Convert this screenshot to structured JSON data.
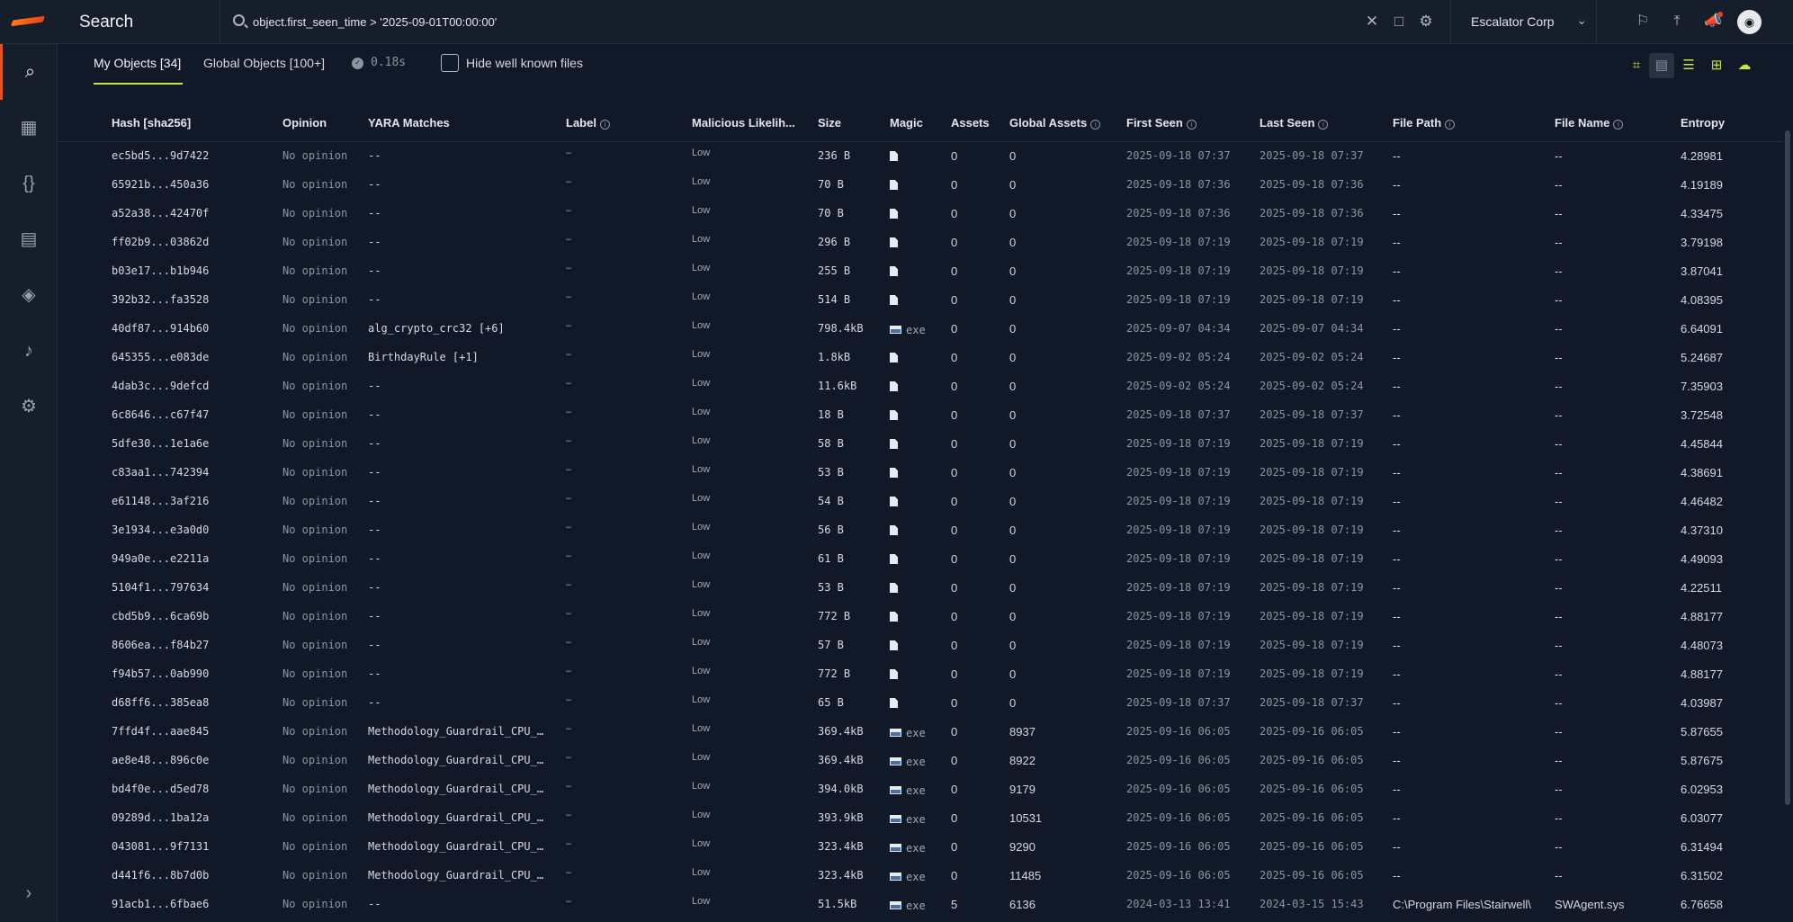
{
  "app": {
    "title": "Search"
  },
  "search": {
    "query": "object.first_seen_time > '2025-09-01T00:00:00'"
  },
  "org": {
    "name": "Escalator Corp"
  },
  "tabs": [
    {
      "label": "My Objects [34]",
      "active": true
    },
    {
      "label": "Global Objects [100+]",
      "active": false
    }
  ],
  "timing": "0.18s",
  "hide_known": {
    "label": "Hide well known files",
    "checked": false
  },
  "columns": [
    "Hash [sha256]",
    "Opinion",
    "YARA Matches",
    "Label",
    "Malicious Likelih...",
    "Size",
    "Magic",
    "Assets",
    "Global Assets",
    "First Seen",
    "Last Seen",
    "File Path",
    "File Name",
    "Entropy"
  ],
  "rows": [
    {
      "hash": "ec5bd5...9d7422",
      "opinion": "No opinion",
      "yara": "--",
      "label": "–",
      "likelihood": "Low",
      "size": "236 B",
      "magic": "file",
      "assets": "0",
      "global_assets": "0",
      "first_seen": "2025-09-18 07:37:2",
      "last_seen": "2025-09-18 07:37:2",
      "file_path": "--",
      "file_name": "--",
      "entropy": "4.28981"
    },
    {
      "hash": "65921b...450a36",
      "opinion": "No opinion",
      "yara": "--",
      "label": "–",
      "likelihood": "Low",
      "size": "70 B",
      "magic": "file",
      "assets": "0",
      "global_assets": "0",
      "first_seen": "2025-09-18 07:36:2",
      "last_seen": "2025-09-18 07:36:2",
      "file_path": "--",
      "file_name": "--",
      "entropy": "4.19189"
    },
    {
      "hash": "a52a38...42470f",
      "opinion": "No opinion",
      "yara": "--",
      "label": "–",
      "likelihood": "Low",
      "size": "70 B",
      "magic": "file",
      "assets": "0",
      "global_assets": "0",
      "first_seen": "2025-09-18 07:36:2",
      "last_seen": "2025-09-18 07:36:2",
      "file_path": "--",
      "file_name": "--",
      "entropy": "4.33475"
    },
    {
      "hash": "ff02b9...03862d",
      "opinion": "No opinion",
      "yara": "--",
      "label": "–",
      "likelihood": "Low",
      "size": "296 B",
      "magic": "file",
      "assets": "0",
      "global_assets": "0",
      "first_seen": "2025-09-18 07:19:2",
      "last_seen": "2025-09-18 07:19:2",
      "file_path": "--",
      "file_name": "--",
      "entropy": "3.79198"
    },
    {
      "hash": "b03e17...b1b946",
      "opinion": "No opinion",
      "yara": "--",
      "label": "–",
      "likelihood": "Low",
      "size": "255 B",
      "magic": "file",
      "assets": "0",
      "global_assets": "0",
      "first_seen": "2025-09-18 07:19:2",
      "last_seen": "2025-09-18 07:19:2",
      "file_path": "--",
      "file_name": "--",
      "entropy": "3.87041"
    },
    {
      "hash": "392b32...fa3528",
      "opinion": "No opinion",
      "yara": "--",
      "label": "–",
      "likelihood": "Low",
      "size": "514 B",
      "magic": "file",
      "assets": "0",
      "global_assets": "0",
      "first_seen": "2025-09-18 07:19:2",
      "last_seen": "2025-09-18 07:19:2",
      "file_path": "--",
      "file_name": "--",
      "entropy": "4.08395"
    },
    {
      "hash": "40df87...914b60",
      "opinion": "No opinion",
      "yara": "alg_crypto_crc32 [+6]",
      "label": "–",
      "likelihood": "Low",
      "size": "798.4kB",
      "magic": "exe",
      "assets": "0",
      "global_assets": "0",
      "first_seen": "2025-09-07 04:34:2",
      "last_seen": "2025-09-07 04:34:2",
      "file_path": "--",
      "file_name": "--",
      "entropy": "6.64091"
    },
    {
      "hash": "645355...e083de",
      "opinion": "No opinion",
      "yara": "BirthdayRule [+1]",
      "label": "–",
      "likelihood": "Low",
      "size": "1.8kB",
      "magic": "file",
      "assets": "0",
      "global_assets": "0",
      "first_seen": "2025-09-02 05:24:2",
      "last_seen": "2025-09-02 05:24:2",
      "file_path": "--",
      "file_name": "--",
      "entropy": "5.24687"
    },
    {
      "hash": "4dab3c...9defcd",
      "opinion": "No opinion",
      "yara": "--",
      "label": "–",
      "likelihood": "Low",
      "size": "11.6kB",
      "magic": "file",
      "assets": "0",
      "global_assets": "0",
      "first_seen": "2025-09-02 05:24:2",
      "last_seen": "2025-09-02 05:24:2",
      "file_path": "--",
      "file_name": "--",
      "entropy": "7.35903"
    },
    {
      "hash": "6c8646...c67f47",
      "opinion": "No opinion",
      "yara": "--",
      "label": "–",
      "likelihood": "Low",
      "size": "18 B",
      "magic": "file",
      "assets": "0",
      "global_assets": "0",
      "first_seen": "2025-09-18 07:37:2",
      "last_seen": "2025-09-18 07:37:2",
      "file_path": "--",
      "file_name": "--",
      "entropy": "3.72548"
    },
    {
      "hash": "5dfe30...1e1a6e",
      "opinion": "No opinion",
      "yara": "--",
      "label": "–",
      "likelihood": "Low",
      "size": "58 B",
      "magic": "file",
      "assets": "0",
      "global_assets": "0",
      "first_seen": "2025-09-18 07:19:2",
      "last_seen": "2025-09-18 07:19:2",
      "file_path": "--",
      "file_name": "--",
      "entropy": "4.45844"
    },
    {
      "hash": "c83aa1...742394",
      "opinion": "No opinion",
      "yara": "--",
      "label": "–",
      "likelihood": "Low",
      "size": "53 B",
      "magic": "file",
      "assets": "0",
      "global_assets": "0",
      "first_seen": "2025-09-18 07:19:2",
      "last_seen": "2025-09-18 07:19:2",
      "file_path": "--",
      "file_name": "--",
      "entropy": "4.38691"
    },
    {
      "hash": "e61148...3af216",
      "opinion": "No opinion",
      "yara": "--",
      "label": "–",
      "likelihood": "Low",
      "size": "54 B",
      "magic": "file",
      "assets": "0",
      "global_assets": "0",
      "first_seen": "2025-09-18 07:19:2",
      "last_seen": "2025-09-18 07:19:2",
      "file_path": "--",
      "file_name": "--",
      "entropy": "4.46482"
    },
    {
      "hash": "3e1934...e3a0d0",
      "opinion": "No opinion",
      "yara": "--",
      "label": "–",
      "likelihood": "Low",
      "size": "56 B",
      "magic": "file",
      "assets": "0",
      "global_assets": "0",
      "first_seen": "2025-09-18 07:19:2",
      "last_seen": "2025-09-18 07:19:2",
      "file_path": "--",
      "file_name": "--",
      "entropy": "4.37310"
    },
    {
      "hash": "949a0e...e2211a",
      "opinion": "No opinion",
      "yara": "--",
      "label": "–",
      "likelihood": "Low",
      "size": "61 B",
      "magic": "file",
      "assets": "0",
      "global_assets": "0",
      "first_seen": "2025-09-18 07:19:2",
      "last_seen": "2025-09-18 07:19:2",
      "file_path": "--",
      "file_name": "--",
      "entropy": "4.49093"
    },
    {
      "hash": "5104f1...797634",
      "opinion": "No opinion",
      "yara": "--",
      "label": "–",
      "likelihood": "Low",
      "size": "53 B",
      "magic": "file",
      "assets": "0",
      "global_assets": "0",
      "first_seen": "2025-09-18 07:19:2",
      "last_seen": "2025-09-18 07:19:2",
      "file_path": "--",
      "file_name": "--",
      "entropy": "4.22511"
    },
    {
      "hash": "cbd5b9...6ca69b",
      "opinion": "No opinion",
      "yara": "--",
      "label": "–",
      "likelihood": "Low",
      "size": "772 B",
      "magic": "file",
      "assets": "0",
      "global_assets": "0",
      "first_seen": "2025-09-18 07:19:2",
      "last_seen": "2025-09-18 07:19:2",
      "file_path": "--",
      "file_name": "--",
      "entropy": "4.88177"
    },
    {
      "hash": "8606ea...f84b27",
      "opinion": "No opinion",
      "yara": "--",
      "label": "–",
      "likelihood": "Low",
      "size": "57 B",
      "magic": "file",
      "assets": "0",
      "global_assets": "0",
      "first_seen": "2025-09-18 07:19:2",
      "last_seen": "2025-09-18 07:19:2",
      "file_path": "--",
      "file_name": "--",
      "entropy": "4.48073"
    },
    {
      "hash": "f94b57...0ab990",
      "opinion": "No opinion",
      "yara": "--",
      "label": "–",
      "likelihood": "Low",
      "size": "772 B",
      "magic": "file",
      "assets": "0",
      "global_assets": "0",
      "first_seen": "2025-09-18 07:19:2",
      "last_seen": "2025-09-18 07:19:2",
      "file_path": "--",
      "file_name": "--",
      "entropy": "4.88177"
    },
    {
      "hash": "d68ff6...385ea8",
      "opinion": "No opinion",
      "yara": "--",
      "label": "–",
      "likelihood": "Low",
      "size": "65 B",
      "magic": "file",
      "assets": "0",
      "global_assets": "0",
      "first_seen": "2025-09-18 07:37:2",
      "last_seen": "2025-09-18 07:37:2",
      "file_path": "--",
      "file_name": "--",
      "entropy": "4.03987"
    },
    {
      "hash": "7ffd4f...aae845",
      "opinion": "No opinion",
      "yara": "Methodology_Guardrail_CPU_…",
      "label": "–",
      "likelihood": "Low",
      "size": "369.4kB",
      "magic": "exe",
      "assets": "0",
      "global_assets": "8937",
      "first_seen": "2025-09-16 06:05:2",
      "last_seen": "2025-09-16 06:05:2",
      "file_path": "--",
      "file_name": "--",
      "entropy": "5.87655"
    },
    {
      "hash": "ae8e48...896c0e",
      "opinion": "No opinion",
      "yara": "Methodology_Guardrail_CPU_…",
      "label": "–",
      "likelihood": "Low",
      "size": "369.4kB",
      "magic": "exe",
      "assets": "0",
      "global_assets": "8922",
      "first_seen": "2025-09-16 06:05:2",
      "last_seen": "2025-09-16 06:05:2",
      "file_path": "--",
      "file_name": "--",
      "entropy": "5.87675"
    },
    {
      "hash": "bd4f0e...d5ed78",
      "opinion": "No opinion",
      "yara": "Methodology_Guardrail_CPU_…",
      "label": "–",
      "likelihood": "Low",
      "size": "394.0kB",
      "magic": "exe",
      "assets": "0",
      "global_assets": "9179",
      "first_seen": "2025-09-16 06:05:2",
      "last_seen": "2025-09-16 06:05:2",
      "file_path": "--",
      "file_name": "--",
      "entropy": "6.02953"
    },
    {
      "hash": "09289d...1ba12a",
      "opinion": "No opinion",
      "yara": "Methodology_Guardrail_CPU_…",
      "label": "–",
      "likelihood": "Low",
      "size": "393.9kB",
      "magic": "exe",
      "assets": "0",
      "global_assets": "10531",
      "first_seen": "2025-09-16 06:05:2",
      "last_seen": "2025-09-16 06:05:2",
      "file_path": "--",
      "file_name": "--",
      "entropy": "6.03077"
    },
    {
      "hash": "043081...9f7131",
      "opinion": "No opinion",
      "yara": "Methodology_Guardrail_CPU_…",
      "label": "–",
      "likelihood": "Low",
      "size": "323.4kB",
      "magic": "exe",
      "assets": "0",
      "global_assets": "9290",
      "first_seen": "2025-09-16 06:05:2",
      "last_seen": "2025-09-16 06:05:2",
      "file_path": "--",
      "file_name": "--",
      "entropy": "6.31494"
    },
    {
      "hash": "d441f6...8b7d0b",
      "opinion": "No opinion",
      "yara": "Methodology_Guardrail_CPU_…",
      "label": "–",
      "likelihood": "Low",
      "size": "323.4kB",
      "magic": "exe",
      "assets": "0",
      "global_assets": "11485",
      "first_seen": "2025-09-16 06:05:2",
      "last_seen": "2025-09-16 06:05:2",
      "file_path": "--",
      "file_name": "--",
      "entropy": "6.31502"
    },
    {
      "hash": "91acb1...6fbae6",
      "opinion": "No opinion",
      "yara": "--",
      "label": "–",
      "likelihood": "Low",
      "size": "51.5kB",
      "magic": "exe",
      "assets": "5",
      "global_assets": "6136",
      "first_seen": "2024-03-13 13:41:2",
      "last_seen": "2024-03-15 15:43:2",
      "file_path": "C:\\Program Files\\Stairwell\\",
      "file_name": "SWAgent.sys",
      "entropy": "6.76658"
    }
  ],
  "colors": {
    "accent": "#c8e83a",
    "brand": "#e8521a",
    "background": "#111827",
    "panel": "#161d2b"
  },
  "icons": {
    "sidebar": [
      "search-icon",
      "dashboard-icon",
      "variables-icon",
      "assets-icon",
      "layers-icon",
      "bell-icon",
      "gear-icon",
      "expand-icon"
    ],
    "top": [
      "clear-icon",
      "bookmark-icon",
      "filter-settings-icon",
      "bookmarks-icon",
      "upload-icon",
      "announcements-icon",
      "user-avatar-icon"
    ],
    "view": [
      "tag-view-icon",
      "clipboard-view-icon",
      "list-view-icon",
      "grid-view-icon",
      "cloud-download-icon"
    ]
  }
}
